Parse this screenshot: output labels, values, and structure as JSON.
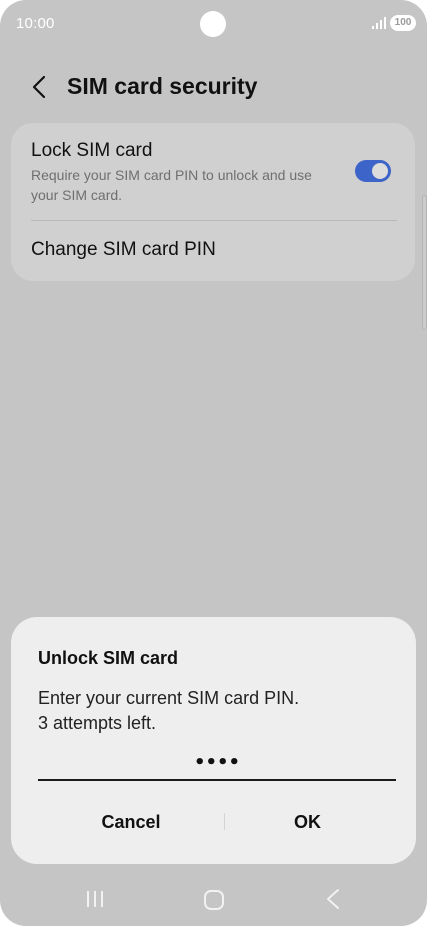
{
  "status_bar": {
    "time": "10:00",
    "battery": "100"
  },
  "header": {
    "title": "SIM card security"
  },
  "settings": {
    "lock": {
      "title": "Lock SIM card",
      "subtitle": "Require your SIM card PIN to unlock and use your SIM card.",
      "enabled": true
    },
    "change_pin": {
      "title": "Change SIM card PIN"
    }
  },
  "dialog": {
    "title": "Unlock SIM card",
    "message_line1": "Enter your current SIM card PIN.",
    "message_line2": "3 attempts left.",
    "pin_value": "••••",
    "cancel_label": "Cancel",
    "ok_label": "OK"
  },
  "colors": {
    "accent": "#3d64c8",
    "background": "#c5c5c5",
    "dialog": "#eeeeee"
  },
  "icons": {
    "back": "chevron-left-icon",
    "nav_recent": "recent-apps-icon",
    "nav_home": "home-icon",
    "nav_back": "back-icon"
  }
}
